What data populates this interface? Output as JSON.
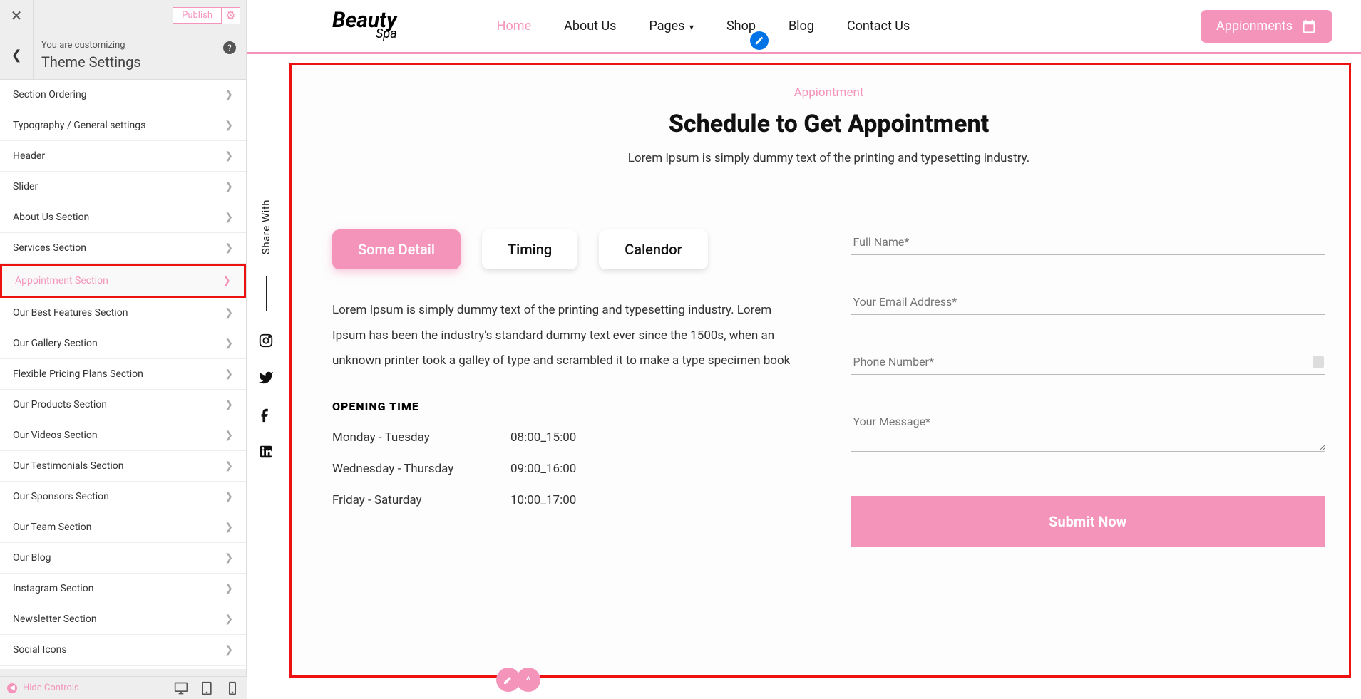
{
  "customizer": {
    "subtitle": "You are customizing",
    "title": "Theme Settings",
    "publish_label": "Publish",
    "hide_controls": "Hide Controls",
    "items": [
      "Section Ordering",
      "Typography / General settings",
      "Header",
      "Slider",
      "About Us Section",
      "Services Section",
      "Appointment Section",
      "Our Best Features Section",
      "Our Gallery Section",
      "Flexible Pricing Plans Section",
      "Our Products Section",
      "Our Videos Section",
      "Our Testimonials Section",
      "Our Sponsors Section",
      "Our Team Section",
      "Our Blog",
      "Instagram Section",
      "Newsletter Section",
      "Social Icons"
    ],
    "active_index": 6
  },
  "site": {
    "logo_top": "Beauty",
    "logo_bottom": "Spa",
    "nav": [
      "Home",
      "About Us",
      "Pages",
      "Shop",
      "Blog",
      "Contact Us"
    ],
    "nav_active_index": 0,
    "appt_button": "Appionments"
  },
  "share": {
    "label": "Share With"
  },
  "appointment": {
    "eyebrow": "Appiontment",
    "title": "Schedule to Get Appointment",
    "description": "Lorem Ipsum is simply dummy text of the printing and typesetting industry.",
    "tabs": [
      "Some Detail",
      "Timing",
      "Calendor"
    ],
    "tab_active_index": 0,
    "paragraph": "Lorem Ipsum is simply dummy text of the printing and typesetting industry. Lorem Ipsum has been the industry's standard dummy text ever since the 1500s, when an unknown printer took a galley of type and scrambled it to make a type specimen book",
    "opening_title": "OPENING TIME",
    "hours": [
      {
        "days": "Monday - Tuesday",
        "time": "08:00_15:00"
      },
      {
        "days": "Wednesday - Thursday",
        "time": "09:00_16:00"
      },
      {
        "days": "Friday - Saturday",
        "time": "10:00_17:00"
      }
    ],
    "form": {
      "name_ph": "Full Name*",
      "email_ph": "Your Email Address*",
      "phone_ph": "Phone Number*",
      "message_ph": "Your Message*",
      "submit_label": "Submit Now"
    }
  }
}
